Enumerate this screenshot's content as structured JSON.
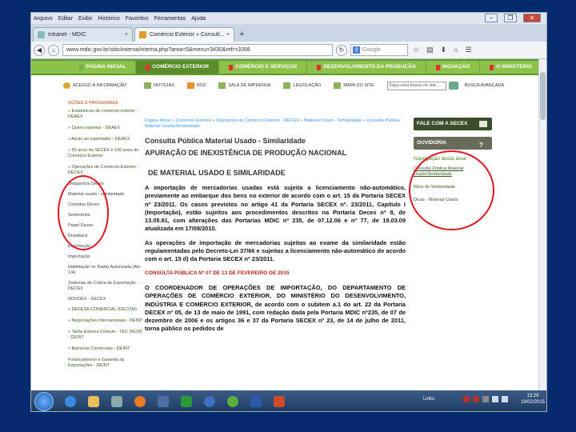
{
  "browser": {
    "menu": [
      "Arquivo",
      "Editar",
      "Exibir",
      "Histórico",
      "Favoritos",
      "Ferramentas",
      "Ajuda"
    ],
    "tabs": [
      {
        "title": "Intranet - MDIC",
        "close": "×"
      },
      {
        "title": "Comércio Exterior » Consult...",
        "close": "×"
      }
    ],
    "new_tab": "+",
    "url": "www.mdic.gov.br/sitio/interna/interna.php?area=5&menu=3430&refr=3358",
    "search_placeholder": "Google",
    "controls": {
      "minimize": "−",
      "restore": "❐",
      "close": "✕"
    }
  },
  "site": {
    "top_nav": [
      "PÁGINA INICIAL",
      "COMÉRCIO EXTERIOR",
      "COMÉRCIO E SERVIÇOS",
      "DESENVOLVIMENTO DA PRODUÇÃO",
      "INOVAÇÃO",
      "O MINISTÉRIO"
    ],
    "sub_nav": [
      "NOTÍCIAS",
      "RSS",
      "SALA DE IMPRENSA",
      "LEGISLAÇÃO",
      "MAPA DO SITE"
    ],
    "search_box": "Faça uma busca no site...",
    "search_advanced": "BUSCA AVANÇADA",
    "accessibility": "ACESSO À INFORMAÇÃO",
    "left_header": "AÇÕES E PROGRAMAS",
    "left_nav": [
      "» Estatísticas de comércio exterior - DEAEX",
      "» Quero exportar - DEAEX",
      "» Apoio ao exportador - DEAEX",
      "» 50 anos da SECEX e 100 anos de Comércio Exterior",
      "» Operações de Comércio Exterior - DECEX",
      "Despachos Decex",
      "Material usado - similaridade",
      "Contatos Decex",
      "Seminários",
      "Papel Decex",
      "Drawback",
      "Exportação",
      "Importação",
      "Habilitação no Radar Autorizada (Ato 1/4)",
      "Sistemas de Coleta de Exportação - DECEX",
      "NOVOEX - DECEX",
      "» DEFESA COMERCIAL (DECOM)",
      "» Negociações Internacionais - DEINT",
      "» Tarifa Externa Comum - TEC (NCM) - DEINT",
      "» Barreiras Comerciais - DEINT",
      "Financiamento e Garantia às Exportações - DEINT"
    ],
    "breadcrumb": "Página Inicial » Comércio Exterior » Operações de Comércio Exterior - DECEX » Material Usado - Similaridade » Consulta Pública Material Usado/Similaridade",
    "page_title": "Consulta Pública Material Usado - Similaridade",
    "headline_1": "APURAÇÃO DE INEXISTÊNCIA DE PRODUÇÃO NACIONAL",
    "headline_2": "DE MATERIAL USADO E SIMILARIDADE",
    "paragraph_1": "A importação de mercadorias usadas está sujeita a licenciamento não-automático, previamente ao embarque dos bens no exterior de acordo com o art. 15 da Portaria SECEX nº 23/2011. Os casos previstos no artigo 41 da Portaria SECEX nº. 23/2011, Capítulo I (Importação), estão sujeitos aos procedimentos descritos na Portaria Decex nº 8, de 13.05.91, com alterações das Portarias MDIC nº 235, de 07.12.06 e nº 77, de 19.03.09 atualizada em 17/08/2010.",
    "paragraph_2": "As operações de importação de mercadorias sujeitas ao exame da similaridade estão regulamentadas pelo Decreto-Lei 37/66 e sujeitas a licenciamento não-automático de acordo com o art. 15 d) da Portaria SECEX nº 23/2011.",
    "notice": "CONSULTA PÚBLICA Nº 07 DE 13 DE FEVEREIRO DE 2015",
    "paragraph_3": "O COORDENADOR DE OPERAÇÕES DE IMPORTAÇÃO, DO DEPARTAMENTO DE OPERAÇÕES DE COMÉRCIO EXTERIOR, DO MINISTÉRIO DO DESENVOLVIMENTO, INDÚSTRIA E COMÉRCIO EXTERIOR, de acordo com o subitem a.1 do art. 22 da Portaria DECEX nº 05, de 13 de maio de 1991, com redação dada pela Portaria MDIC nº235, de 07 de dezembro de 2006 e os artigos 36 e 37 da Portaria SECEX nº 23, de 14 de julho de 2011, torna público os pedidos de",
    "right_buttons": [
      "FALE COM A SECEX",
      "OUVIDORIA"
    ],
    "nav_title": "Navegação desta área",
    "nav_links": [
      "Consulta Pública Material Usado/Similaridade",
      "Ritos de Similaridade",
      "Dicas - Material Usado"
    ]
  },
  "taskbar": {
    "links_label": "Links",
    "time": "13:29",
    "date": "19/02/2015"
  },
  "colors": {
    "desktop": "#062a6e",
    "green": "#8cc14a",
    "annotation": "#e4141e"
  }
}
